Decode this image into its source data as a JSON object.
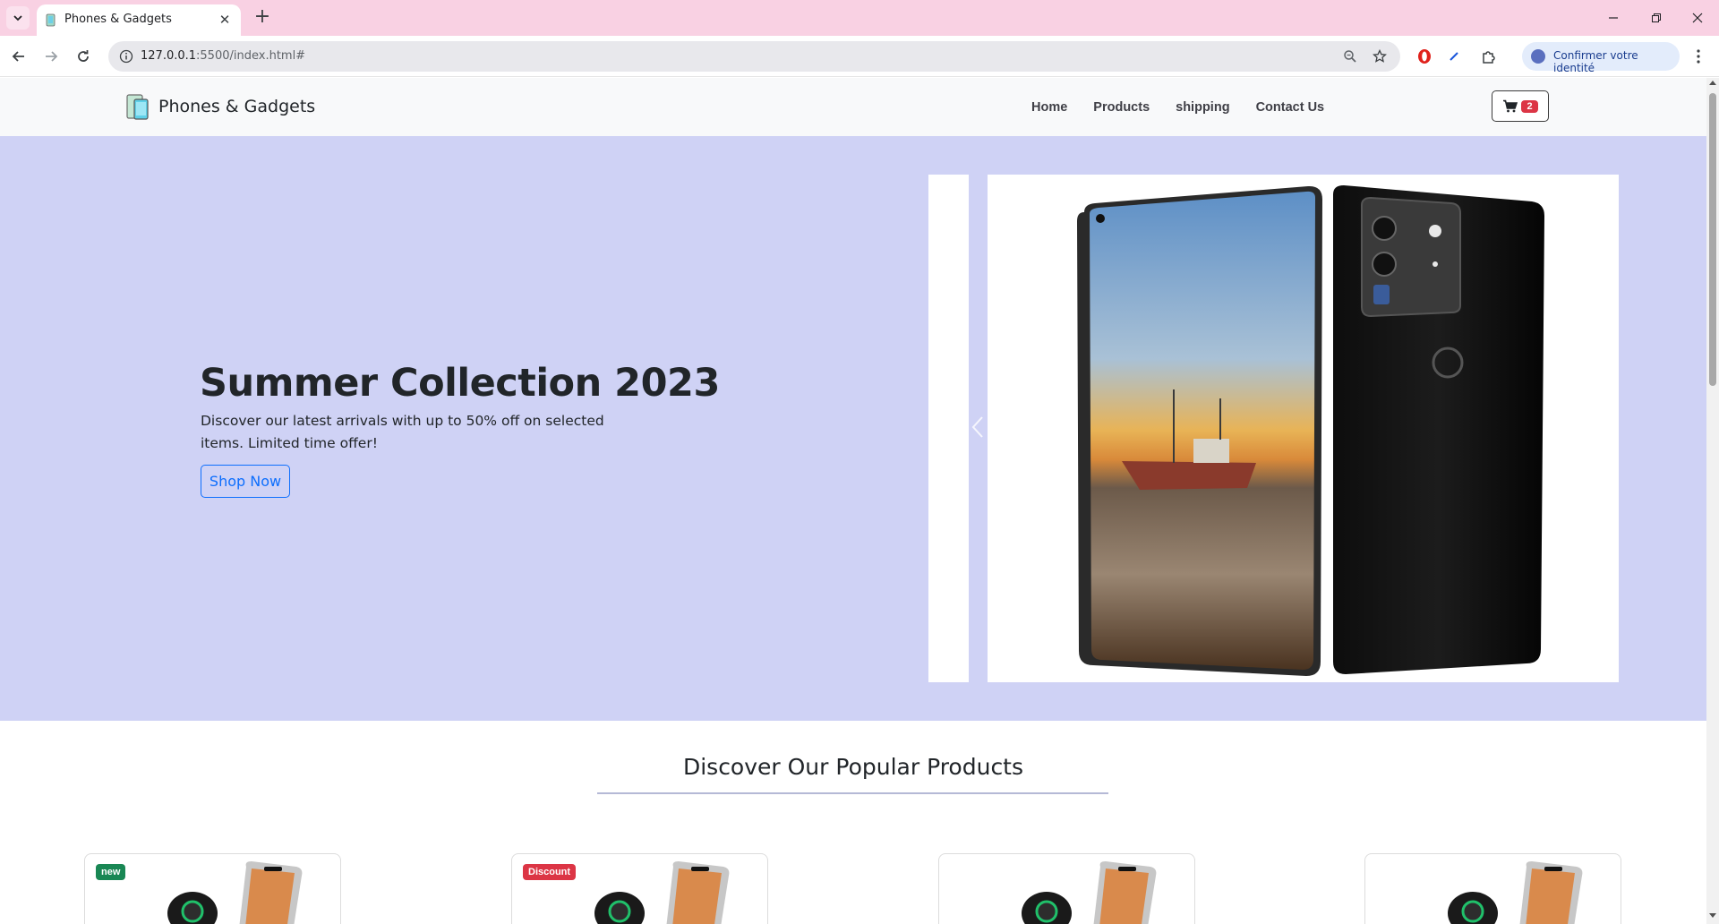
{
  "browser": {
    "tab_title": "Phones & Gadgets",
    "url_host": "127.0.0.1",
    "url_rest": ":5500/index.html#",
    "identity_label": "Confirmer votre identité"
  },
  "site": {
    "brand": "Phones & Gadgets",
    "nav": [
      "Home",
      "Products",
      "shipping",
      "Contact Us"
    ],
    "cart_count": "2"
  },
  "hero": {
    "title": "Summer Collection 2023",
    "description": "Discover our latest arrivals with up to 50% off on selected items. Limited time offer!",
    "button": "Shop Now"
  },
  "popular": {
    "title": "Discover Our Popular Products",
    "products": [
      {
        "badge": "new",
        "badge_color": "#198754"
      },
      {
        "badge": "Discount",
        "badge_color": "#dc3545"
      },
      {
        "badge": "",
        "badge_color": ""
      },
      {
        "badge": "",
        "badge_color": ""
      }
    ]
  },
  "colors": {
    "tabstrip": "#f9d1e3",
    "hero_bg": "#cfd2f5",
    "navbar_bg": "#f8f9fa",
    "primary": "#0d6efd",
    "danger": "#dc3545",
    "success": "#198754"
  },
  "icons": {
    "tab_search": "chevron-down-icon",
    "back": "arrow-left-icon",
    "forward": "arrow-right-icon",
    "reload": "reload-icon",
    "site_info": "info-icon",
    "zoom": "zoom-icon",
    "bookmark": "star-icon",
    "extensions": "puzzle-icon",
    "cart": "cart-icon"
  }
}
